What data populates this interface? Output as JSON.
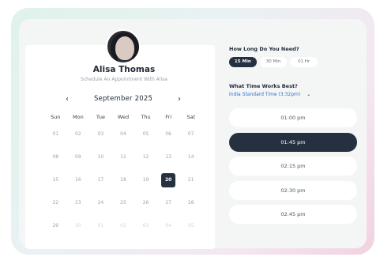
{
  "profile": {
    "name": "Alisa Thomas",
    "subtitle": "Schedule An Appointment With Alisa"
  },
  "calendar": {
    "prev_icon": "‹",
    "next_icon": "›",
    "month_label": "September 2025",
    "weekdays": [
      "Sun",
      "Mon",
      "Tue",
      "Wed",
      "Thu",
      "Fri",
      "Sat"
    ],
    "selected_day": "20",
    "rows": [
      [
        "01",
        "02",
        "03",
        "04",
        "05",
        "06",
        "07"
      ],
      [
        "08",
        "09",
        "10",
        "11",
        "12",
        "13",
        "14"
      ],
      [
        "15",
        "16",
        "17",
        "18",
        "19",
        "20",
        "21"
      ],
      [
        "22",
        "23",
        "24",
        "25",
        "26",
        "27",
        "28"
      ],
      [
        "29",
        "30",
        "01",
        "02",
        "03",
        "04",
        "05"
      ]
    ]
  },
  "duration": {
    "question": "How Long Do You Need?",
    "options": [
      "15 Min",
      "30 Min",
      "01 Hr"
    ],
    "selected": "15 Min"
  },
  "time": {
    "question": "What Time Works Best?",
    "timezone": "India Standard Time (3:32pm)",
    "timezone_caret": "⌄",
    "slots": [
      "01:00 pm",
      "01:45 pm",
      "02:15 pm",
      "02:30 pm",
      "02:45 pm"
    ],
    "selected_slot": "01:45 pm"
  },
  "colors": {
    "accent_dark": "#253040",
    "link_blue": "#2f6fd6"
  }
}
